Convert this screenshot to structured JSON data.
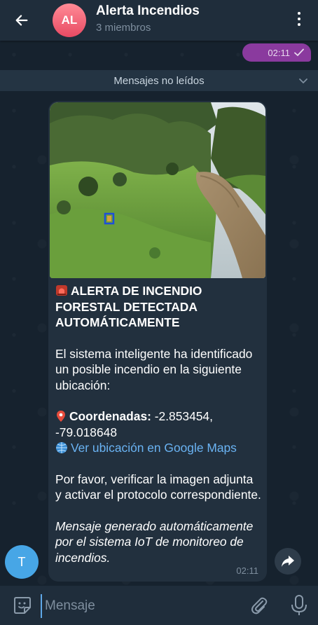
{
  "header": {
    "avatar_initials": "AL",
    "title": "Alerta Incendios",
    "subtitle": "3 miembros",
    "back_icon": "arrow-left-icon",
    "menu_icon": "more-vertical-icon"
  },
  "outgoing_message": {
    "time": "02:11",
    "status_icon": "single-check-icon"
  },
  "unread_separator": {
    "label": "Mensajes no leídos"
  },
  "message": {
    "title": "ALERTA DE INCENDIO FORESTAL DETECTADA AUTOMÁTICAMENTE",
    "intro": "El sistema inteligente ha identificado un posible incendio en la siguiente ubicación:",
    "coords_label": "Coordenadas:",
    "coords_value": " -2.853454, -79.018648",
    "maps_link": "Ver ubicación en Google Maps",
    "request": "Por favor, verificar la imagen adjunta y activar el protocolo correspondiente.",
    "footer": "Mensaje generado automáticamente por el sistema IoT de monitoreo de incendios.",
    "time": "02:11"
  },
  "sender_avatar_initial": "T",
  "input": {
    "placeholder": "Mensaje"
  },
  "colors": {
    "header_bg": "#1f2d3b",
    "chat_bg": "#16222e",
    "bubble_in": "#22303e",
    "bubble_out": "#8a3a9e",
    "link": "#6ab3f3",
    "accent_avatar": "#e84a63",
    "user_avatar": "#47a6e6"
  }
}
